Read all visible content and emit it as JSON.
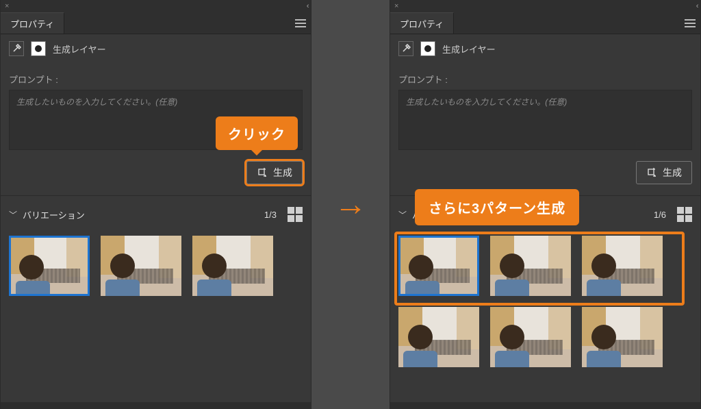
{
  "left": {
    "tab_title": "プロパティ",
    "layer_label": "生成レイヤー",
    "prompt_label": "プロンプト :",
    "prompt_placeholder": "生成したいものを入力してください。(任意)",
    "generate_label": "生成",
    "variations_label": "バリエーション",
    "variations_count": "1/3",
    "callout_click": "クリック"
  },
  "right": {
    "tab_title": "プロパティ",
    "layer_label": "生成レイヤー",
    "prompt_label": "プロンプト :",
    "prompt_placeholder": "生成したいものを入力してください。(任意)",
    "generate_label": "生成",
    "variations_label_short": "バ",
    "variations_count": "1/6",
    "callout_more": "さらに3パターン生成"
  },
  "arrow_glyph": "→",
  "collapse_glyph": "‹‹",
  "close_glyph": "×"
}
